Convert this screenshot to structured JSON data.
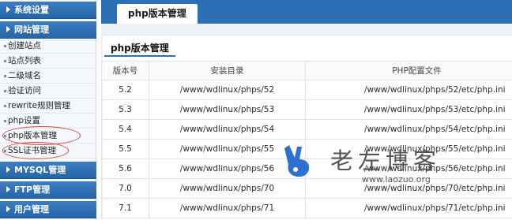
{
  "sidebar": {
    "groups": {
      "system": "系统设置",
      "site": "网站管理",
      "mysql": "MYSQL管理",
      "ftp": "FTP管理",
      "user": "用户管理"
    },
    "items": [
      {
        "label": "创建站点"
      },
      {
        "label": "站点列表"
      },
      {
        "label": "二级域名"
      },
      {
        "label": "验证访问"
      },
      {
        "label": "rewrite规则管理"
      },
      {
        "label": "php设置"
      },
      {
        "label": "php版本管理"
      },
      {
        "label": "SSL证书管理"
      }
    ]
  },
  "main": {
    "tab_label": "php版本管理",
    "panel_title": "php版本管理",
    "table": {
      "headers": [
        "版本号",
        "安装目录",
        "PHP配置文件"
      ],
      "rows": [
        [
          "5.2",
          "/www/wdlinux/phps/52",
          "/www/wdlinux/phps/52/etc/php.ini"
        ],
        [
          "5.3",
          "/www/wdlinux/phps/53",
          "/www/wdlinux/phps/53/etc/php.ini"
        ],
        [
          "5.4",
          "/www/wdlinux/phps/54",
          "/www/wdlinux/phps/54/etc/php.ini"
        ],
        [
          "5.5",
          "/www/wdlinux/phps/55",
          "/www/wdlinux/phps/55/etc/php.ini"
        ],
        [
          "5.6",
          "/www/wdlinux/phps/56",
          "/www/wdlinux/phps/56/etc/php.ini"
        ],
        [
          "7.0",
          "/www/wdlinux/phps/70",
          "/www/wdlinux/phps/70/etc/php.ini"
        ],
        [
          "7.1",
          "/www/wdlinux/phps/71",
          "/www/wdlinux/phps/71/etc/php.ini"
        ]
      ]
    }
  },
  "watermark": {
    "name": "老左博客",
    "url": "www.laozuo.org"
  },
  "colors": {
    "sidebar_header": "#2d6fb5",
    "topbar": "#2d6fb5",
    "annotation_oval": "#d94848",
    "logo_blue": "#2f6fd1"
  }
}
